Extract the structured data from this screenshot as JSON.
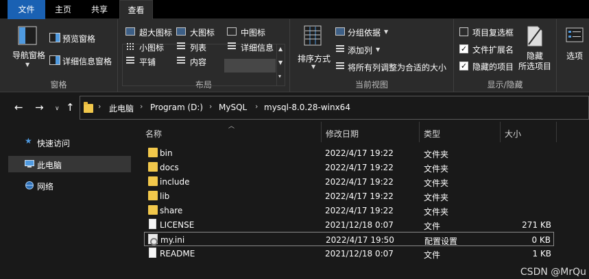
{
  "tabs": {
    "file": "文件",
    "home": "主页",
    "share": "共享",
    "view": "查看"
  },
  "ribbon": {
    "panes": {
      "nav_pane": "导航窗格",
      "preview_pane": "预览窗格",
      "details_pane": "详细信息窗格",
      "label": "窗格"
    },
    "layout": {
      "extra_large": "超大图标",
      "large": "大图标",
      "medium": "中图标",
      "small": "小图标",
      "list": "列表",
      "details": "详细信息",
      "tiles": "平铺",
      "content": "内容",
      "label": "布局"
    },
    "current_view": {
      "sort_by": "排序方式",
      "group_by": "分组依据",
      "add_columns": "添加列",
      "size_all_columns": "将所有列调整为合适的大小",
      "label": "当前视图"
    },
    "show_hide": {
      "item_checkboxes": "项目复选框",
      "item_checkboxes_checked": false,
      "file_extensions": "文件扩展名",
      "file_extensions_checked": true,
      "hidden_items": "隐藏的项目",
      "hidden_items_checked": true,
      "hide_selected": "隐藏",
      "hide_selected_2": "所选项目",
      "label": "显示/隐藏"
    },
    "options": "选项"
  },
  "address": {
    "crumbs": [
      "此电脑",
      "Program (D:)",
      "MySQL",
      "mysql-8.0.28-winx64"
    ]
  },
  "sidebar": {
    "items": [
      {
        "label": "快速访问",
        "icon": "star-icon"
      },
      {
        "label": "此电脑",
        "icon": "computer-icon"
      },
      {
        "label": "网络",
        "icon": "network-icon"
      }
    ]
  },
  "columns": {
    "name": "名称",
    "modified": "修改日期",
    "type": "类型",
    "size": "大小"
  },
  "files": [
    {
      "name": "bin",
      "modified": "2022/4/17 19:22",
      "type": "文件夹",
      "size": "",
      "icon": "folder-icon"
    },
    {
      "name": "docs",
      "modified": "2022/4/17 19:22",
      "type": "文件夹",
      "size": "",
      "icon": "folder-icon"
    },
    {
      "name": "include",
      "modified": "2022/4/17 19:22",
      "type": "文件夹",
      "size": "",
      "icon": "folder-icon"
    },
    {
      "name": "lib",
      "modified": "2022/4/17 19:22",
      "type": "文件夹",
      "size": "",
      "icon": "folder-icon"
    },
    {
      "name": "share",
      "modified": "2022/4/17 19:22",
      "type": "文件夹",
      "size": "",
      "icon": "folder-icon"
    },
    {
      "name": "LICENSE",
      "modified": "2021/12/18 0:07",
      "type": "文件",
      "size": "271 KB",
      "icon": "file-icon"
    },
    {
      "name": "my.ini",
      "modified": "2022/4/17 19:50",
      "type": "配置设置",
      "size": "0 KB",
      "icon": "settings-file-icon"
    },
    {
      "name": "README",
      "modified": "2021/12/18 0:07",
      "type": "文件",
      "size": "1 KB",
      "icon": "file-icon"
    }
  ],
  "watermark": "CSDN @MrQu",
  "colors": {
    "accent": "#1a61b3",
    "folder": "#f2c84b",
    "background": "#191919",
    "ribbon": "#2b2b2b"
  }
}
